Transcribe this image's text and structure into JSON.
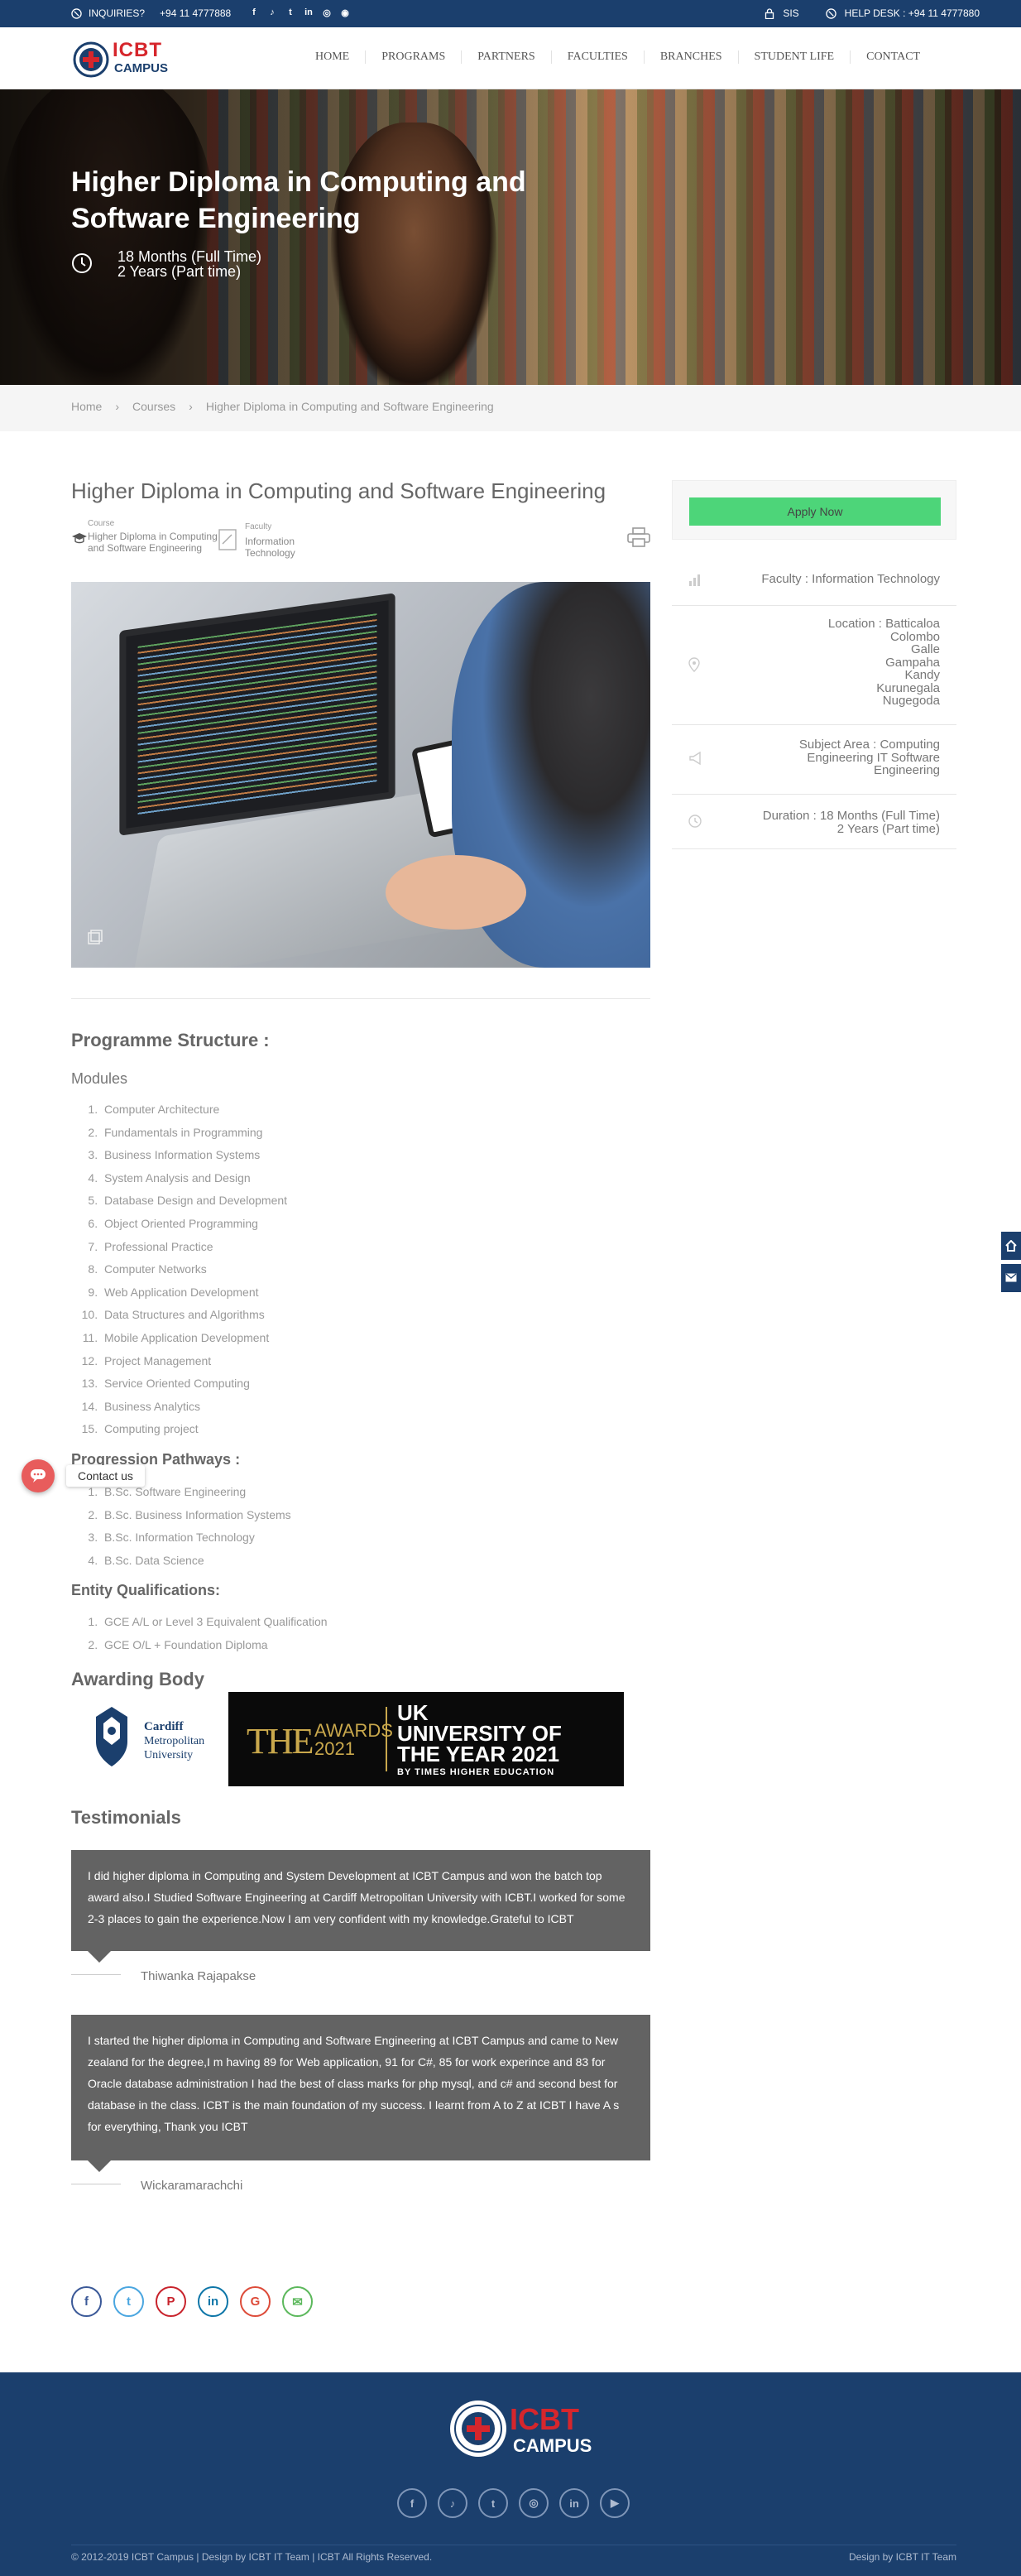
{
  "topbar": {
    "inquiries_label": "INQUIRIES?",
    "inquiries_phone": "+94 11 4777888",
    "social": [
      "f",
      "♪",
      "t",
      "in",
      "◎",
      "◉"
    ],
    "sis_label": "SIS",
    "helpdesk_label": "HELP DESK : +94 11 4777880"
  },
  "logo": {
    "text_top": "ICBT",
    "text_bottom": "CAMPUS"
  },
  "nav": [
    "HOME",
    "PROGRAMS",
    "PARTNERS",
    "FACULTIES",
    "BRANCHES",
    "STUDENT LIFE",
    "CONTACT"
  ],
  "hero": {
    "title": "Higher Diploma in Computing and Software Engineering",
    "duration_full": "18 Months (Full Time)",
    "duration_part": "2 Years (Part time)"
  },
  "breadcrumb": [
    "Home",
    "Courses",
    "Higher Diploma in Computing and Software Engineering"
  ],
  "course": {
    "title": "Higher Diploma in Computing and Software Engineering",
    "course_label": "Course",
    "course_value": "Higher Diploma in Computing and Software Engineering",
    "faculty_label": "Faculty",
    "faculty_value": "Information Technology"
  },
  "sidebar": {
    "apply": "Apply Now",
    "faculty": "Faculty : Information Technology",
    "location_label": "Location : Batticaloa",
    "locations": [
      "Colombo",
      "Galle",
      "Gampaha",
      "Kandy",
      "Kurunegala",
      "Nugegoda"
    ],
    "subject_area": "Subject Area : Computing Engineering IT Software Engineering",
    "duration_full": "Duration : 18 Months (Full Time)",
    "duration_part": "2 Years (Part time)"
  },
  "programme": {
    "heading": "Programme Structure :",
    "modules_heading": "Modules",
    "modules": [
      "Computer Architecture",
      "Fundamentals in Programming",
      "Business Information Systems",
      "System Analysis and Design",
      "Database Design and Development",
      "Object Oriented Programming",
      "Professional Practice",
      "Computer Networks",
      "Web Application Development",
      "Data Structures and Algorithms",
      "Mobile Application Development",
      "Project Management",
      "Service Oriented Computing",
      "Business Analytics",
      "Computing project"
    ],
    "pathways_heading": "Progression Pathways :",
    "pathways": [
      "B.Sc. Software Engineering",
      "B.Sc. Business Information Systems",
      "B.Sc. Information Technology",
      "B.Sc. Data Science"
    ],
    "entry_heading": "Entity Qualifications:",
    "entry": [
      "GCE A/L or Level 3 Equivalent Qualification",
      "GCE O/L + Foundation Diploma"
    ]
  },
  "awarding": {
    "heading": "Awarding Body",
    "cardiff": [
      "Cardiff",
      "Metropolitan",
      "University"
    ],
    "the_awards": "THE",
    "awards_word": "AWARDS",
    "awards_year": "2021",
    "uk_line1": "UK",
    "uk_line2": "UNIVERSITY OF",
    "uk_line3": "THE YEAR 2021",
    "uk_line4": "BY TIMES HIGHER EDUCATION"
  },
  "testimonials": {
    "heading": "Testimonials",
    "items": [
      {
        "text": "I did higher diploma in Computing and System Development at ICBT Campus and won the batch top award also.I Studied Software Engineering at Cardiff Metropolitan University with ICBT.I worked for some 2-3 places to gain the experience.Now I am very confident with my knowledge.Grateful to ICBT",
        "name": "Thiwanka Rajapakse"
      },
      {
        "text": "I started the higher diploma in Computing and Software Engineering at ICBT Campus and came to New zealand for the degree,I m having 89 for Web application, 91 for C#, 85 for work experince and 83 for Oracle database administration I had the best of class marks for php mysql, and c# and second best for database in the class.  ICBT is the main foundation of my success. I learnt from A to Z at ICBT I have A s for everything, Thank you ICBT",
        "name": "Wickaramarachchi"
      }
    ]
  },
  "share": [
    {
      "glyph": "f",
      "color": "#3b5998"
    },
    {
      "glyph": "t",
      "color": "#4aa6e0"
    },
    {
      "glyph": "P",
      "color": "#c8232c"
    },
    {
      "glyph": "in",
      "color": "#0e76a8"
    },
    {
      "glyph": "G",
      "color": "#dd4b39"
    },
    {
      "glyph": "✉",
      "color": "#5cb85c"
    }
  ],
  "contact": {
    "label": "Contact us"
  },
  "footer": {
    "social": [
      "f",
      "♪",
      "t",
      "◎",
      "in",
      "▶"
    ],
    "copyright": "© 2012-2019 ICBT Campus | Design by ICBT IT Team | ICBT All Rights Reserved.",
    "design": "Design by ICBT IT Team"
  }
}
